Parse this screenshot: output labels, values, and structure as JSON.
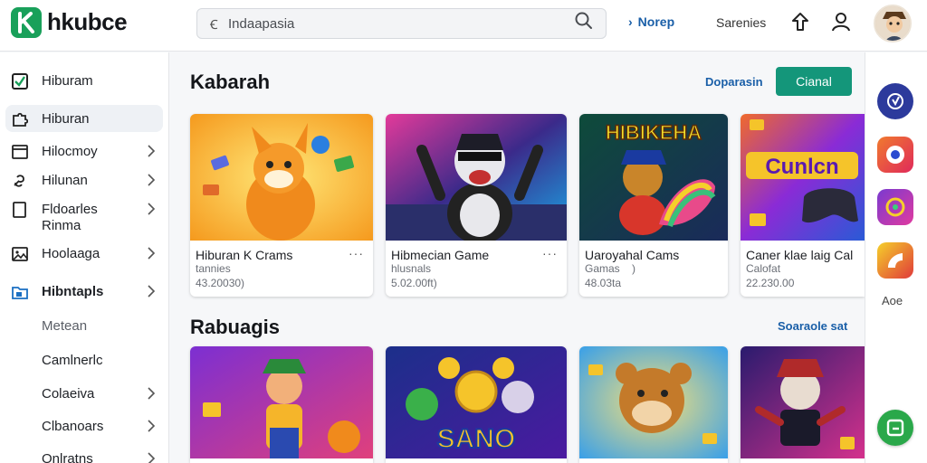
{
  "header": {
    "logo_text": "hkubce",
    "search_lead": "Ꞓ",
    "search_placeholder": "Indaapasia",
    "nav_link": "Norep",
    "nav_text": "Sarenies"
  },
  "sidebar": {
    "items": [
      {
        "label": "Hiburam",
        "icon": "checkbox-icon",
        "chevron": false
      },
      {
        "label": "Hiburan",
        "icon": "puzzle-icon",
        "chevron": false
      },
      {
        "label": "Hilocmoy",
        "icon": "window-icon",
        "chevron": true
      },
      {
        "label": "Hilunan",
        "icon": "link-icon",
        "chevron": true
      },
      {
        "label": "Fldoarles",
        "label2": "Rinma",
        "icon": "square-icon",
        "chevron": true
      },
      {
        "label": "Hoolaaga",
        "icon": "image-icon",
        "chevron": true
      },
      {
        "label": "Hibntapls",
        "icon": "folder-icon",
        "chevron": true
      },
      {
        "label": "Metean",
        "chevron": false
      },
      {
        "label": "Camlnerlc",
        "chevron": false
      },
      {
        "label": "Colaeiva",
        "chevron": true
      },
      {
        "label": "Clbanoars",
        "chevron": true
      },
      {
        "label": "Onlratns",
        "chevron": true
      }
    ]
  },
  "main": {
    "section1": {
      "title": "Kabarah",
      "link": "Doparasin",
      "button": "Cianal"
    },
    "cards": [
      {
        "title": "Hiburan K Crams",
        "subtitle": "tannies",
        "meta": "43.20030)",
        "more": "···",
        "thumb_colors": [
          "#ffd23a",
          "#f59a1e"
        ]
      },
      {
        "title": "Hibmecian Game",
        "subtitle": "hlusnals",
        "meta": "5.02.00ft)",
        "more": "···",
        "thumb_colors": [
          "#3b2a8a",
          "#1aa7e6"
        ]
      },
      {
        "title": "Uaroyahal Cams",
        "subtitle": "Gamas",
        "subtitle_extra": ")",
        "meta": "48.03ta",
        "more": "",
        "thumb_colors": [
          "#0e4b3a",
          "#d8362b"
        ]
      },
      {
        "title": "Caner klae laig Cal",
        "subtitle": "Calofat",
        "meta": "22.230.00",
        "more": "",
        "thumb_colors": [
          "#5a2bd6",
          "#f06a2c"
        ]
      }
    ],
    "section2": {
      "title": "Rabuagis",
      "link": "Soaraole sat"
    },
    "thumb_text": {
      "banner_a": "HIBIKEHA",
      "banner_b": "Cunlcn",
      "coin": "SANO"
    },
    "cards_row2": [
      {
        "thumb_colors": [
          "#7c2fd2",
          "#e0407c"
        ]
      },
      {
        "thumb_colors": [
          "#1c2f8a",
          "#d9a521"
        ]
      },
      {
        "thumb_colors": [
          "#e8a32a",
          "#3aa0e8"
        ]
      },
      {
        "thumb_colors": [
          "#2a1b6e",
          "#d4318c"
        ]
      }
    ]
  },
  "rail": {
    "label": "Aoe",
    "buttons": [
      {
        "name": "rail-app-1",
        "color": "#2c3a9c"
      },
      {
        "name": "rail-app-2",
        "color": "#f04a2e"
      },
      {
        "name": "rail-app-3",
        "color": "#c43ad0"
      },
      {
        "name": "rail-app-4",
        "color": "#f2a22a"
      }
    ]
  }
}
